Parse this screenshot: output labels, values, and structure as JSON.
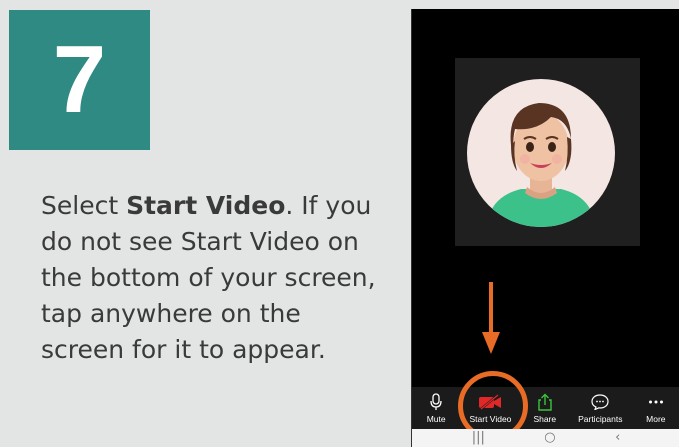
{
  "step": {
    "number": "7"
  },
  "instructions": {
    "prefix": "Select ",
    "bold": "Start Video",
    "suffix": ". If you do not see Start Video on the bottom of your screen, tap anywhere on the screen for it to appear."
  },
  "toolbar": {
    "items": [
      {
        "label": "Mute",
        "icon": "microphone-icon"
      },
      {
        "label": "Start Video",
        "icon": "video-off-icon"
      },
      {
        "label": "Share",
        "icon": "share-icon"
      },
      {
        "label": "Participants",
        "icon": "participants-icon"
      },
      {
        "label": "More",
        "icon": "more-icon"
      }
    ]
  },
  "navbar": {
    "recents": "|||",
    "home": "○",
    "back": "‹"
  },
  "colors": {
    "step_bg": "#2e8a83",
    "highlight": "#e86b26",
    "video_off": "#e02828",
    "share": "#3bc43b"
  }
}
